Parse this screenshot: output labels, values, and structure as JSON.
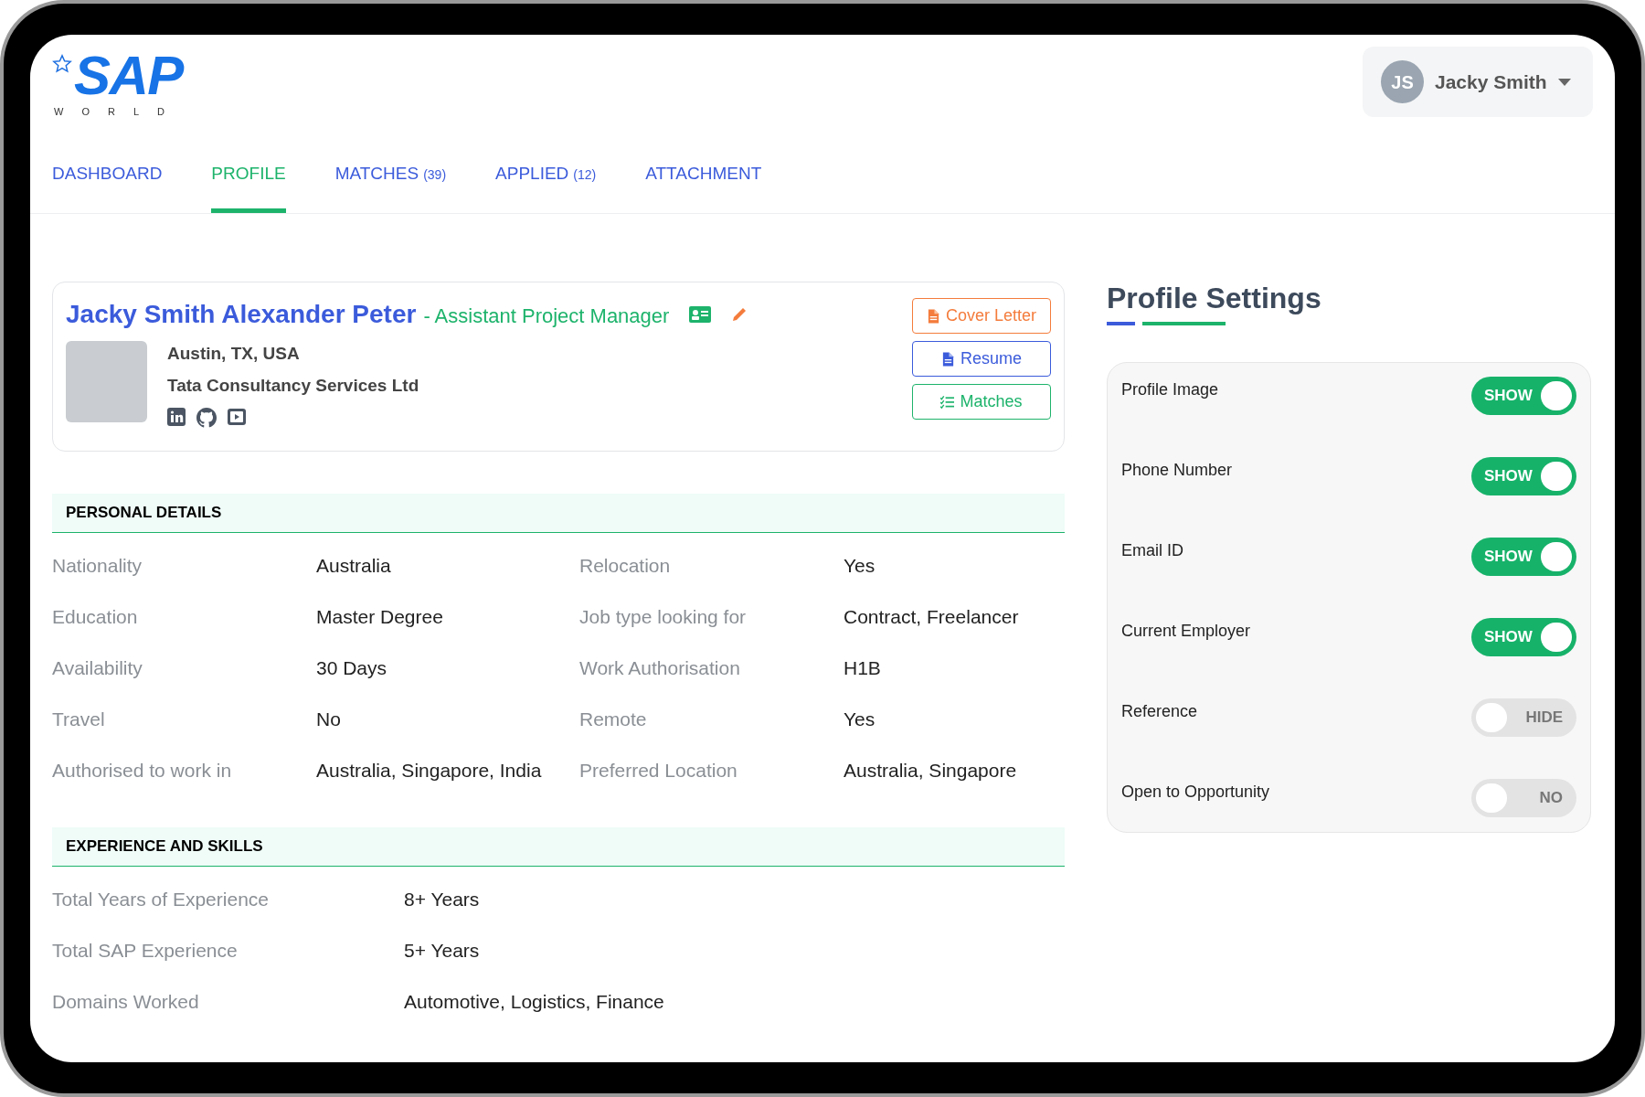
{
  "logo": {
    "wordmark": "SAP",
    "tagline": "WORLD"
  },
  "user_menu": {
    "initials": "JS",
    "name": "Jacky Smith"
  },
  "tabs": [
    {
      "label": "DASHBOARD",
      "selected": false
    },
    {
      "label": "PROFILE",
      "selected": true
    },
    {
      "label": "MATCHES",
      "count": "(39)",
      "selected": false
    },
    {
      "label": "APPLIED",
      "count": "(12)",
      "selected": false
    },
    {
      "label": "ATTACHMENT",
      "selected": false
    }
  ],
  "profile": {
    "name": "Jacky Smith Alexander Peter",
    "title": "- Assistant Project Manager",
    "location": "Austin, TX, USA",
    "company": "Tata Consultancy Services Ltd",
    "buttons": [
      {
        "label": "Cover Letter",
        "kind": "cover"
      },
      {
        "label": "Resume",
        "kind": "resume"
      },
      {
        "label": "Matches",
        "kind": "matches"
      }
    ]
  },
  "personal_details": {
    "heading": "PERSONAL DETAILS",
    "fields": [
      {
        "label": "Nationality",
        "value": "Australia"
      },
      {
        "label": "Relocation",
        "value": "Yes"
      },
      {
        "label": "Education",
        "value": "Master Degree"
      },
      {
        "label": "Job type looking for",
        "value": "Contract, Freelancer"
      },
      {
        "label": "Availability",
        "value": "30 Days"
      },
      {
        "label": "Work Authorisation",
        "value": "H1B"
      },
      {
        "label": "Travel",
        "value": "No"
      },
      {
        "label": "Remote",
        "value": "Yes"
      },
      {
        "label": "Authorised to work in",
        "value": "Australia, Singapore, India"
      },
      {
        "label": "Preferred Location",
        "value": "Australia, Singapore"
      }
    ]
  },
  "experience": {
    "heading": "EXPERIENCE AND SKILLS",
    "fields": [
      {
        "label": "Total Years of Experience",
        "value": "8+ Years"
      },
      {
        "label": "Total SAP Experience",
        "value": "5+ Years"
      },
      {
        "label": "Domains Worked",
        "value": "Automotive, Logistics, Finance"
      }
    ]
  },
  "profile_settings": {
    "title": "Profile Settings",
    "settings": [
      {
        "label": "Profile Image",
        "on": true,
        "state_label": "SHOW"
      },
      {
        "label": "Phone Number",
        "on": true,
        "state_label": "SHOW"
      },
      {
        "label": "Email ID",
        "on": true,
        "state_label": "SHOW"
      },
      {
        "label": "Current Employer",
        "on": true,
        "state_label": "SHOW"
      },
      {
        "label": "Reference",
        "on": false,
        "state_label": "HIDE"
      },
      {
        "label": "Open to Opportunity",
        "on": false,
        "state_label": "NO"
      }
    ]
  }
}
